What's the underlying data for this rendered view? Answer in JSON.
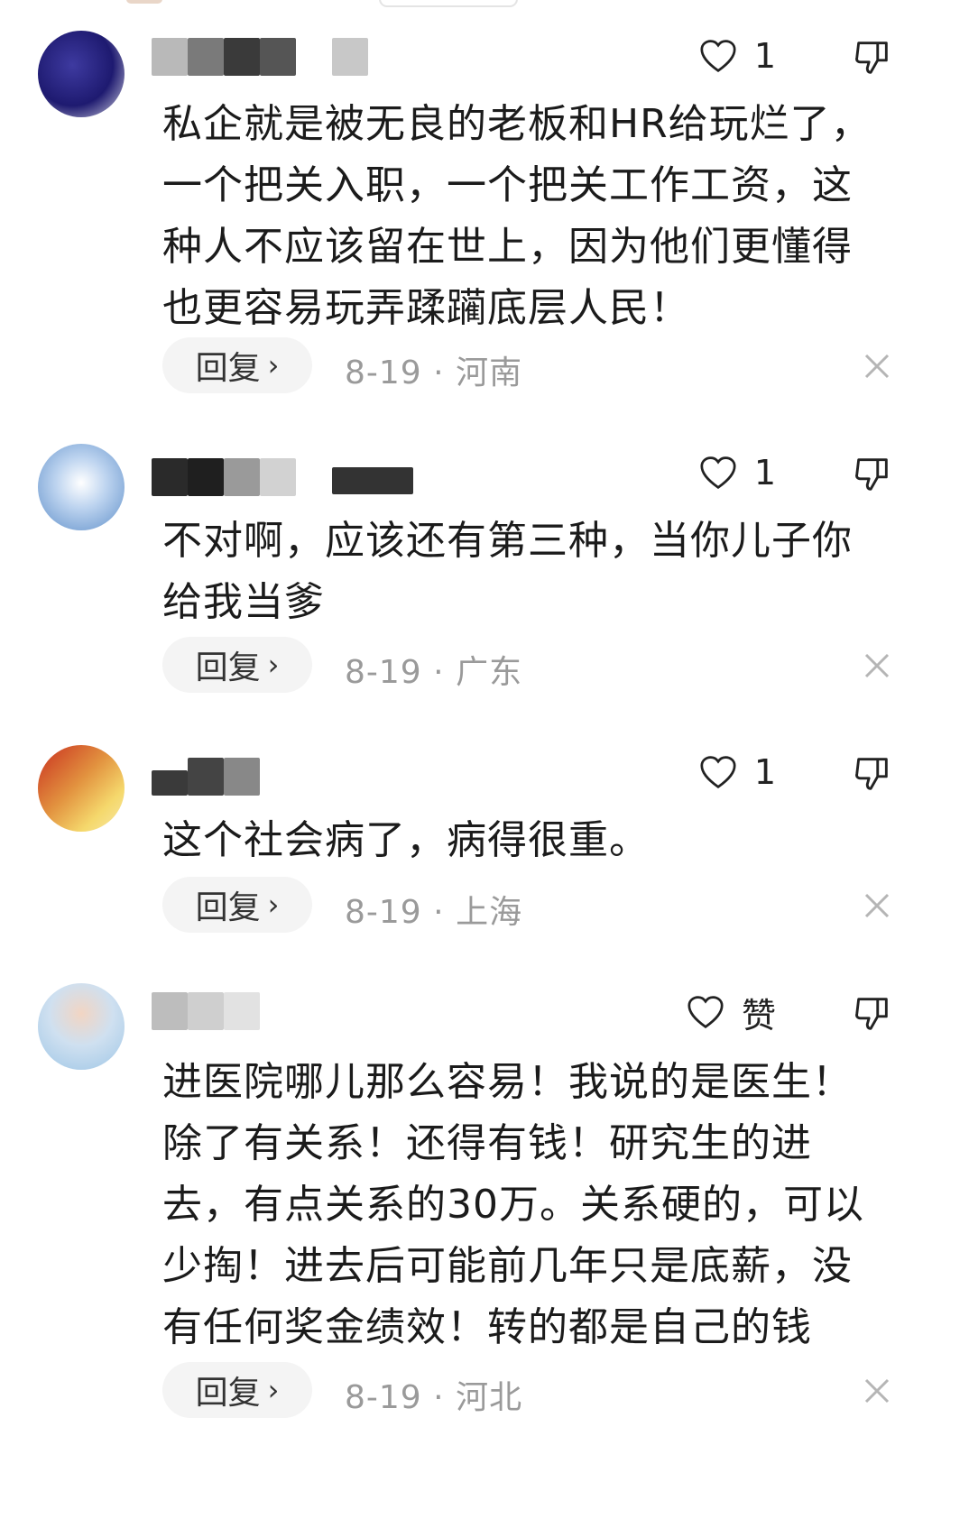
{
  "comments": [
    {
      "like_count": "1",
      "text": "私企就是被无良的老板和HR给玩烂了，\n一个把关入职，一个把关工作工资，这\n种人不应该留在世上，因为他们更懂得\n也更容易玩弄蹂躏底层人民！",
      "reply_label": "回复",
      "date": "8-19",
      "location": "河南"
    },
    {
      "like_count": "1",
      "text": "不对啊，应该还有第三种，当你儿子你\n给我当爹",
      "reply_label": "回复",
      "date": "8-19",
      "location": "广东"
    },
    {
      "like_count": "1",
      "text": "这个社会病了，病得很重。",
      "reply_label": "回复",
      "date": "8-19",
      "location": "上海"
    },
    {
      "like_count": "赞",
      "text": "进医院哪儿那么容易！我说的是医生！\n除了有关系！还得有钱！研究生的进\n去，有点关系的30万。关系硬的，可以\n少掏！进去后可能前几年只是底薪，没\n有任何奖金绩效！转的都是自己的钱",
      "reply_label": "回复",
      "date": "8-19",
      "location": "河北"
    }
  ],
  "meta_separator": "·",
  "icons": {
    "like": "heart-icon",
    "dislike": "thumbs-down-icon",
    "close": "close-icon",
    "chevron": "chevron-right-icon"
  },
  "colors": {
    "meta_text": "#9a9a9a",
    "reply_bg": "#f4f4f4"
  }
}
